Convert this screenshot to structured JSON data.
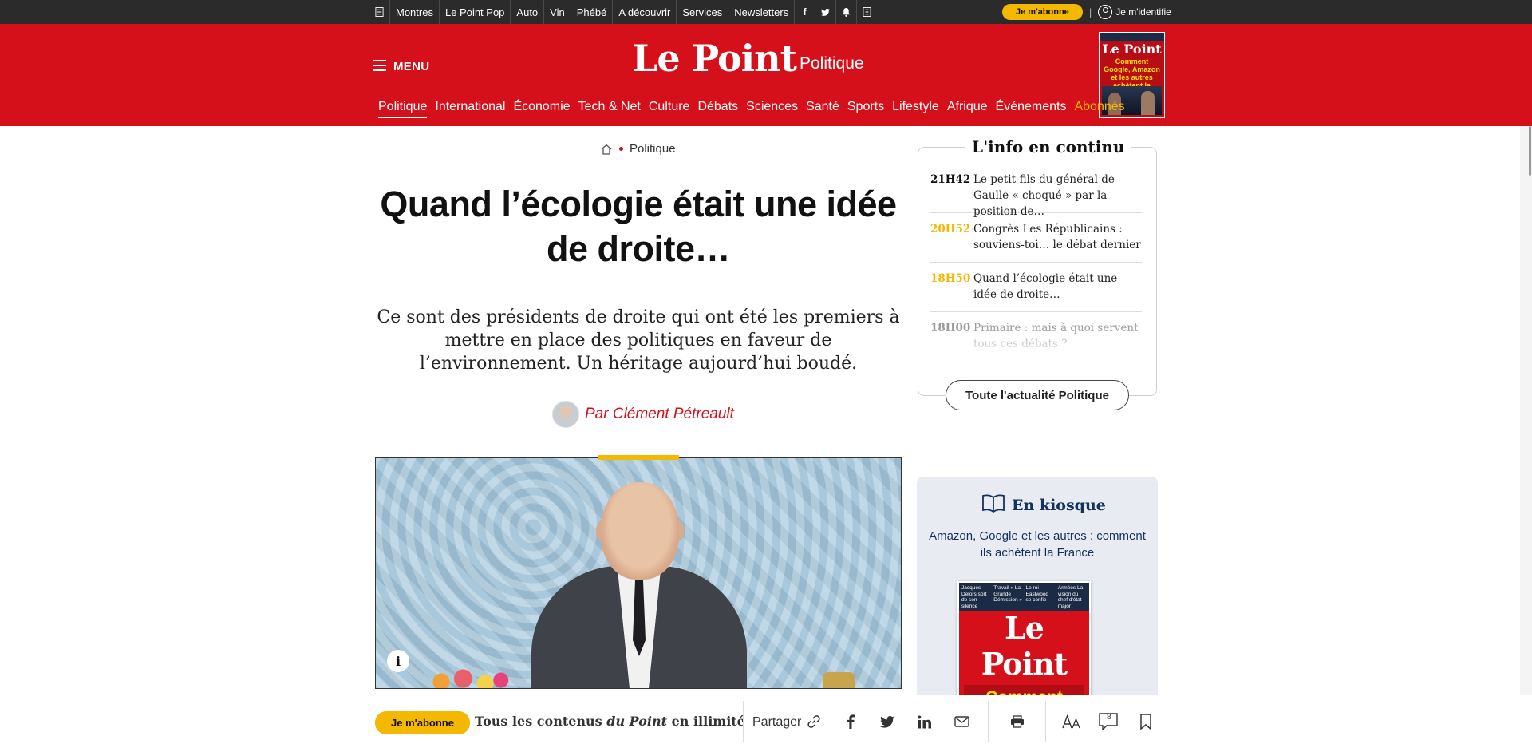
{
  "topbar": {
    "items": [
      "Montres",
      "Le Point Pop",
      "Auto",
      "Vin",
      "Phébé",
      "A découvrir",
      "Services",
      "Newsletters"
    ],
    "subscribe": "Je m'abonne",
    "separator": "|",
    "login": "Je m'identifie"
  },
  "header": {
    "menu_label": "MENU",
    "logo": "Le Point",
    "section": "Politique",
    "cover_thumb": {
      "logo": "Le Point",
      "headline": "Comment Google, Amazon et les autres achètent la France"
    },
    "nav": [
      {
        "label": "Politique",
        "state": "active"
      },
      {
        "label": "International"
      },
      {
        "label": "Économie"
      },
      {
        "label": "Tech & Net"
      },
      {
        "label": "Culture"
      },
      {
        "label": "Débats"
      },
      {
        "label": "Sciences"
      },
      {
        "label": "Santé"
      },
      {
        "label": "Sports"
      },
      {
        "label": "Lifestyle"
      },
      {
        "label": "Afrique"
      },
      {
        "label": "Événements"
      },
      {
        "label": "Abonnés",
        "state": "highlight"
      }
    ]
  },
  "article": {
    "breadcrumb": "Politique",
    "title": "Quand l’écologie était une idée de droite…",
    "chapo": "Ce sont des présidents de droite qui ont été les premiers à mettre en place des politiques en faveur de l’environnement. Un héritage aujourd’hui boudé.",
    "author": "Par Clément Pétreault",
    "image_info": "i"
  },
  "live": {
    "title": "L'info en continu",
    "items": [
      {
        "time": "21H42",
        "text": "Le petit-fils du général de Gaulle « choqué » par la position de…"
      },
      {
        "time": "20H52",
        "text": "Congrès Les Républicains : souviens-toi… le débat dernier"
      },
      {
        "time": "18H50",
        "text": "Quand l’écologie était une idée de droite…"
      },
      {
        "time": "18H00",
        "text": "Primaire : mais à quoi servent tous ces débats ?"
      }
    ],
    "all_button": "Toute l'actualité Politique"
  },
  "kiosk": {
    "title": "En kiosque",
    "subtitle": "Amazon, Google et les autres : comment ils achètent la France",
    "cover_teasers": [
      "Jacques Delors sort de son silence",
      "Travail « La Grande Démission »",
      "Le roi Eastwood se confie",
      "Armées La vision du chef d'état-major"
    ],
    "cover_logo": "Le Point",
    "cover_headline": "Comment Google, Amazon et les autres"
  },
  "bottombar": {
    "subscribe": "Je m'abonne",
    "text_before": "Tous les contenus ",
    "text_em": "du Point",
    "text_after": " en illimité",
    "share_label": "Partager",
    "comment_count": "8"
  },
  "colors": {
    "brand_red": "#d5101a",
    "gold": "#f5b800",
    "navy": "#14325a"
  }
}
